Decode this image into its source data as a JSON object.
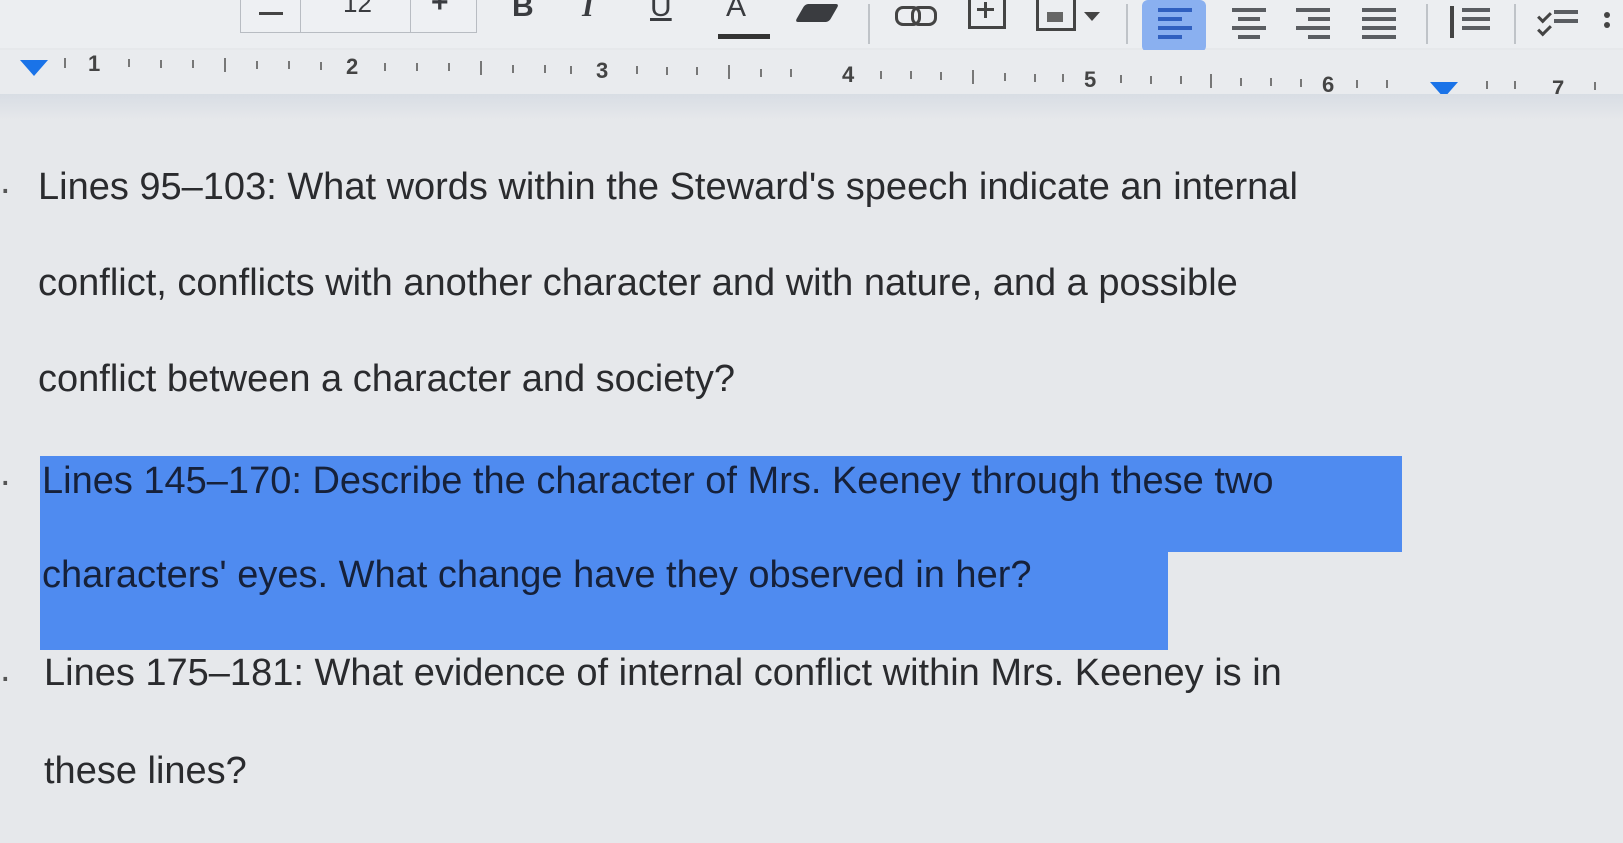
{
  "toolbar": {
    "font_size": "12",
    "plus": "+",
    "bold": "B",
    "italic": "I",
    "underline": "U",
    "text_color": "A",
    "icons": [
      "minus-icon",
      "plus-icon",
      "bold-icon",
      "italic-icon",
      "underline-icon",
      "text-color-icon",
      "highlight-pen-icon",
      "link-icon",
      "comment-icon",
      "image-icon",
      "align-left-icon",
      "align-center-icon",
      "align-right-icon",
      "justify-icon",
      "line-spacing-icon",
      "checklist-icon"
    ],
    "accent": "#8ab0f0"
  },
  "ruler": {
    "numbers": [
      "1",
      "2",
      "3",
      "4",
      "5",
      "6",
      "7"
    ]
  },
  "document": {
    "q1": {
      "line1": "Lines 95–103: What words within the Steward's speech indicate an internal",
      "line2": "conflict, conflicts with another character and with nature, and a possible",
      "line3": "conflict between a character and society?"
    },
    "q2": {
      "line1": "Lines 145–170: Describe the character of Mrs. Keeney through these two",
      "line2": "characters' eyes. What change have they observed in her?"
    },
    "q3": {
      "line1": "Lines 175–181: What evidence of internal conflict within Mrs. Keeney is in",
      "line2": "these lines?"
    },
    "selection_color": "#4f8bf0"
  }
}
